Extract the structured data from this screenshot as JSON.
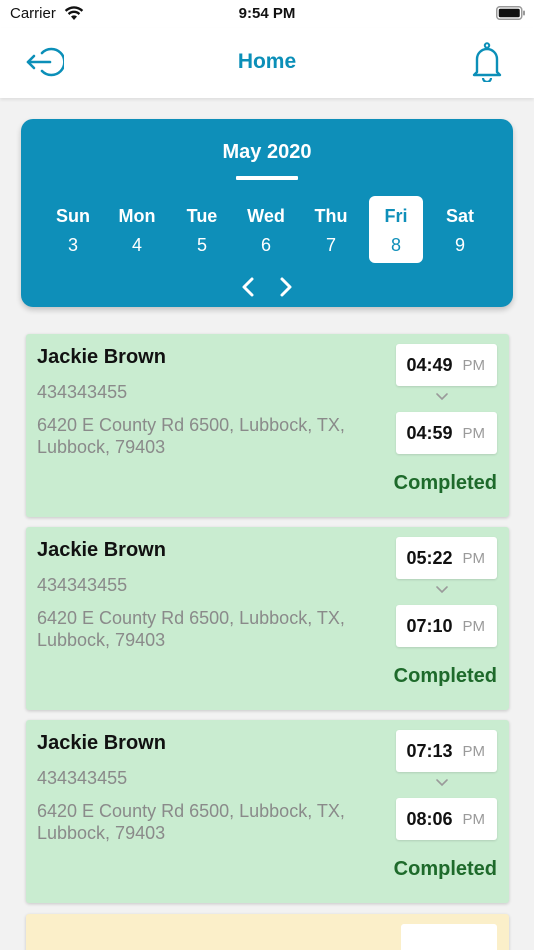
{
  "status_bar": {
    "carrier": "Carrier",
    "time": "9:54 PM"
  },
  "header": {
    "title": "Home",
    "left_icon": "logout-icon",
    "right_icon": "bell-icon",
    "accent_color": "#0b8fb8"
  },
  "calendar": {
    "month": "May 2020",
    "background_color": "#0e8fb9",
    "days": [
      {
        "name": "Sun",
        "num": "3",
        "selected": false
      },
      {
        "name": "Mon",
        "num": "4",
        "selected": false
      },
      {
        "name": "Tue",
        "num": "5",
        "selected": false
      },
      {
        "name": "Wed",
        "num": "6",
        "selected": false
      },
      {
        "name": "Thu",
        "num": "7",
        "selected": false
      },
      {
        "name": "Fri",
        "num": "8",
        "selected": true
      },
      {
        "name": "Sat",
        "num": "9",
        "selected": false
      }
    ]
  },
  "appointments": [
    {
      "name": "Jackie Brown",
      "phone": "434343455",
      "address": "6420 E County Rd 6500, Lubbock, TX, Lubbock, 79403",
      "start_time": "04:49",
      "start_ampm": "PM",
      "end_time": "04:59",
      "end_ampm": "PM",
      "status": "Completed"
    },
    {
      "name": "Jackie Brown",
      "phone": "434343455",
      "address": "6420 E County Rd 6500, Lubbock, TX, Lubbock, 79403",
      "start_time": "05:22",
      "start_ampm": "PM",
      "end_time": "07:10",
      "end_ampm": "PM",
      "status": "Completed"
    },
    {
      "name": "Jackie Brown",
      "phone": "434343455",
      "address": "6420 E County Rd 6500, Lubbock, TX, Lubbock, 79403",
      "start_time": "07:13",
      "start_ampm": "PM",
      "end_time": "08:06",
      "end_ampm": "PM",
      "status": "Completed"
    }
  ],
  "colors": {
    "completed_card": "#c9ecd0",
    "completed_text": "#1e6a2b",
    "pending_card": "#fbefc9"
  }
}
